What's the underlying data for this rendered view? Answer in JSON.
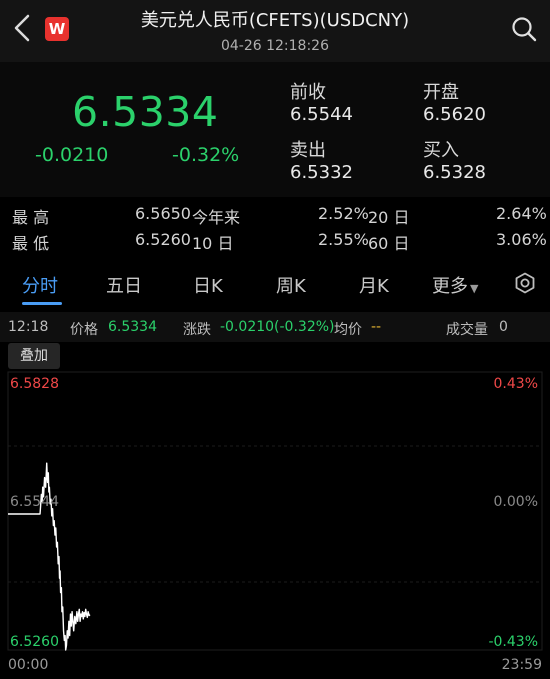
{
  "header": {
    "title": "美元兑人民币(CFETS)(USDCNY)",
    "subtitle": "04-26 12:18:26",
    "logo_letter": "W",
    "logo_color": "#e8322e"
  },
  "quote": {
    "price": "6.5334",
    "change": "-0.0210",
    "change_pct": "-0.32%",
    "prev_close_label": "前收",
    "prev_close": "6.5544",
    "open_label": "开盘",
    "open": "6.5620",
    "sell_label": "卖出",
    "sell": "6.5332",
    "buy_label": "买入",
    "buy": "6.5328",
    "color_down": "#2bd16b"
  },
  "stats": {
    "high_label": "最 高",
    "high": "6.5650",
    "ytd_label": "今年来",
    "ytd": "2.52%",
    "d20_label": "20 日",
    "d20": "2.64%",
    "low_label": "最 低",
    "low": "6.5260",
    "d10_label": "10 日",
    "d10": "2.55%",
    "d60_label": "60 日",
    "d60": "3.06%"
  },
  "tabs": [
    {
      "label": "分时",
      "active": true
    },
    {
      "label": "五日"
    },
    {
      "label": "日K"
    },
    {
      "label": "周K"
    },
    {
      "label": "月K"
    },
    {
      "label": "更多"
    }
  ],
  "info_bar": {
    "time": "12:18",
    "price_label": "价格",
    "price": "6.5334",
    "change_label": "涨跌",
    "change": "-0.0210(-0.32%)",
    "avg_label": "均价",
    "avg": "--",
    "volume_label": "成交量",
    "volume": "0"
  },
  "overlay_button": "叠加",
  "chart_data": {
    "type": "line",
    "y_labels_left": [
      "6.5828",
      "6.5544",
      "6.5260"
    ],
    "y_labels_right": [
      "0.43%",
      "0.00%",
      "-0.43%"
    ],
    "x_labels": [
      "00:00",
      "23:59"
    ],
    "ylim": [
      6.526,
      6.5828
    ],
    "reference": 6.5544,
    "series": [
      {
        "x": [
          0,
          12,
          12.2,
          12.5,
          12.8,
          13.0,
          13.3,
          13.7,
          14.1,
          14.5,
          14.8,
          15.1,
          15.3,
          15.5,
          15.8,
          16.1,
          16.4,
          16.7,
          17.0,
          17.3,
          17.6,
          17.9,
          18.2,
          18.5,
          18.8,
          19.1,
          19.3,
          19.5,
          19.7,
          20.0,
          20.2,
          20.5,
          20.8,
          21.1,
          21.4,
          21.6,
          21.9,
          22.2,
          22.5,
          22.8,
          23.1,
          23.4,
          23.7,
          24.0,
          24.3,
          24.6,
          25.0,
          25.4,
          25.8,
          26.1,
          26.4,
          26.7,
          27.0,
          27.3,
          27.6,
          27.9,
          28.2,
          28.5,
          28.8,
          29.1,
          29.4,
          29.7,
          30.0,
          30.4,
          30.7
        ],
        "y": [
          6.5544,
          6.5544,
          6.556,
          6.5585,
          6.557,
          6.56,
          6.558,
          6.562,
          6.56,
          6.565,
          6.561,
          6.563,
          6.559,
          6.56,
          6.5565,
          6.5575,
          6.554,
          6.5555,
          6.552,
          6.553,
          6.55,
          6.5515,
          6.5475,
          6.5485,
          6.544,
          6.5455,
          6.541,
          6.5425,
          6.538,
          6.539,
          6.534,
          6.535,
          6.53,
          6.528,
          6.529,
          6.526,
          6.527,
          6.53,
          6.5285,
          6.532,
          6.529,
          6.5335,
          6.531,
          6.534,
          6.532,
          6.53,
          6.533,
          6.5315,
          6.534,
          6.532,
          6.5335,
          6.5345,
          6.532,
          6.5335,
          6.533,
          6.534,
          6.5325,
          6.5338,
          6.533,
          6.5345,
          6.5335,
          6.5328,
          6.534,
          6.5332,
          6.5334
        ]
      }
    ],
    "x_range": [
      0,
      200
    ],
    "colors": {
      "line": "#ffffff",
      "ref": "#ffffff",
      "up": "#f04848",
      "down": "#2bd16b",
      "neutral": "#8a8a8a"
    }
  }
}
